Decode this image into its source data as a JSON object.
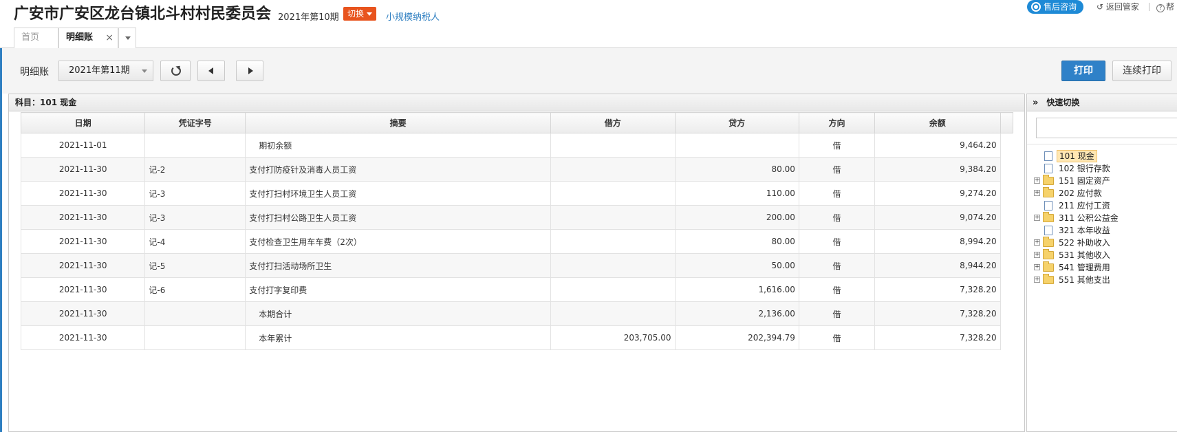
{
  "header": {
    "org_name": "广安市广安区龙台镇北斗村村民委员会",
    "period": "2021年第10期",
    "switch_label": "切换",
    "taxpayer_type": "小规模纳税人",
    "after_sales": "售后咨询",
    "back_label": "返回管家",
    "help_label": "帮"
  },
  "tabs": [
    {
      "label": "首页"
    },
    {
      "label": "明细账",
      "close": "×"
    }
  ],
  "toolbar": {
    "label": "明细账",
    "selected_period": "2021年第11期",
    "print_label": "打印",
    "continuous_print_label": "连续打印"
  },
  "ledger": {
    "subject": "科目：101  现金",
    "columns": [
      "日期",
      "凭证字号",
      "摘要",
      "借方",
      "贷方",
      "方向",
      "余额"
    ],
    "rows": [
      {
        "date": "2021-11-01",
        "voucher": "",
        "summary": "期初余额",
        "debit": "",
        "credit": "",
        "direction": "借",
        "balance": "9,464.20"
      },
      {
        "date": "2021-11-30",
        "voucher": "记-2",
        "summary": "支付打防疫针及消毒人员工资",
        "debit": "",
        "credit": "80.00",
        "direction": "借",
        "balance": "9,384.20"
      },
      {
        "date": "2021-11-30",
        "voucher": "记-3",
        "summary": "支付打扫村环境卫生人员工资",
        "debit": "",
        "credit": "110.00",
        "direction": "借",
        "balance": "9,274.20"
      },
      {
        "date": "2021-11-30",
        "voucher": "记-3",
        "summary": "支付打扫村公路卫生人员工资",
        "debit": "",
        "credit": "200.00",
        "direction": "借",
        "balance": "9,074.20"
      },
      {
        "date": "2021-11-30",
        "voucher": "记-4",
        "summary": "支付检查卫生用车车费（2次）",
        "debit": "",
        "credit": "80.00",
        "direction": "借",
        "balance": "8,994.20"
      },
      {
        "date": "2021-11-30",
        "voucher": "记-5",
        "summary": "支付打扫活动场所卫生",
        "debit": "",
        "credit": "50.00",
        "direction": "借",
        "balance": "8,944.20"
      },
      {
        "date": "2021-11-30",
        "voucher": "记-6",
        "summary": "支付打字复印费",
        "debit": "",
        "credit": "1,616.00",
        "direction": "借",
        "balance": "7,328.20"
      },
      {
        "date": "2021-11-30",
        "voucher": "",
        "summary": "本期合计",
        "debit": "",
        "credit": "2,136.00",
        "direction": "借",
        "balance": "7,328.20"
      },
      {
        "date": "2021-11-30",
        "voucher": "",
        "summary": "本年累计",
        "debit": "203,705.00",
        "credit": "202,394.79",
        "direction": "借",
        "balance": "7,328.20"
      }
    ]
  },
  "quick_switch": {
    "title": "快速切换",
    "search_placeholder": "",
    "items": [
      {
        "label": "101 现金",
        "type": "doc",
        "expandable": false,
        "selected": true
      },
      {
        "label": "102 银行存款",
        "type": "doc",
        "expandable": false,
        "selected": false
      },
      {
        "label": "151 固定资产",
        "type": "folder",
        "expandable": true,
        "selected": false
      },
      {
        "label": "202 应付款",
        "type": "folder",
        "expandable": true,
        "selected": false
      },
      {
        "label": "211 应付工资",
        "type": "doc",
        "expandable": false,
        "selected": false
      },
      {
        "label": "311 公积公益金",
        "type": "folder",
        "expandable": true,
        "selected": false
      },
      {
        "label": "321 本年收益",
        "type": "doc",
        "expandable": false,
        "selected": false
      },
      {
        "label": "522 补助收入",
        "type": "folder",
        "expandable": true,
        "selected": false
      },
      {
        "label": "531 其他收入",
        "type": "folder",
        "expandable": true,
        "selected": false
      },
      {
        "label": "541 管理费用",
        "type": "folder",
        "expandable": true,
        "selected": false
      },
      {
        "label": "551 其他支出",
        "type": "folder",
        "expandable": true,
        "selected": false
      }
    ]
  },
  "colors": {
    "accent": "#2f81c8",
    "switch": "#e8541e",
    "selected_item": "#ffe7b3"
  }
}
